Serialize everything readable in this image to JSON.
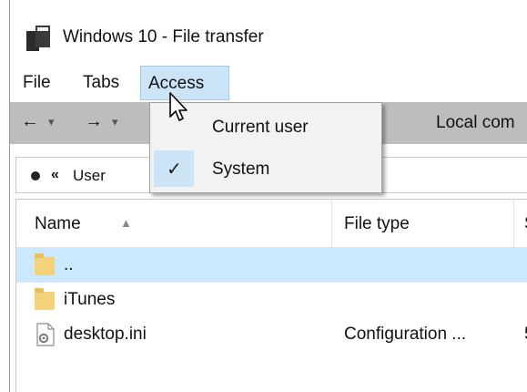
{
  "window": {
    "title": "Windows 10 - File transfer"
  },
  "menubar": {
    "items": [
      {
        "label": "File"
      },
      {
        "label": "Tabs"
      },
      {
        "label": "Access"
      }
    ]
  },
  "access_menu": {
    "items": [
      {
        "label": "Current user",
        "checked": false
      },
      {
        "label": "System",
        "checked": true
      }
    ],
    "check_glyph": "✓"
  },
  "navbar": {
    "back_glyph": "←",
    "forward_glyph": "→",
    "dropdown_glyph": "▾",
    "location_text": "Local com"
  },
  "pathbar": {
    "chevron": "«",
    "segment": "User"
  },
  "filelist": {
    "columns": [
      {
        "label": "Name",
        "sorted": "ascending"
      },
      {
        "label": "File type"
      },
      {
        "label": "S"
      }
    ],
    "sort_glyph": "▲",
    "rows": [
      {
        "name": "..",
        "type": "",
        "size": "",
        "icon": "folder-icon",
        "selected": true
      },
      {
        "name": "iTunes",
        "type": "",
        "size": "",
        "icon": "folder-icon",
        "selected": false
      },
      {
        "name": "desktop.ini",
        "type": "Configuration ...",
        "size": "5",
        "icon": "settings-file-icon",
        "selected": false
      }
    ]
  },
  "colors": {
    "menu_highlight": "#cce4f7",
    "selected_row": "#cce8ff",
    "navbar_bg": "#bdbdbd",
    "folder": "#f3d27a"
  }
}
